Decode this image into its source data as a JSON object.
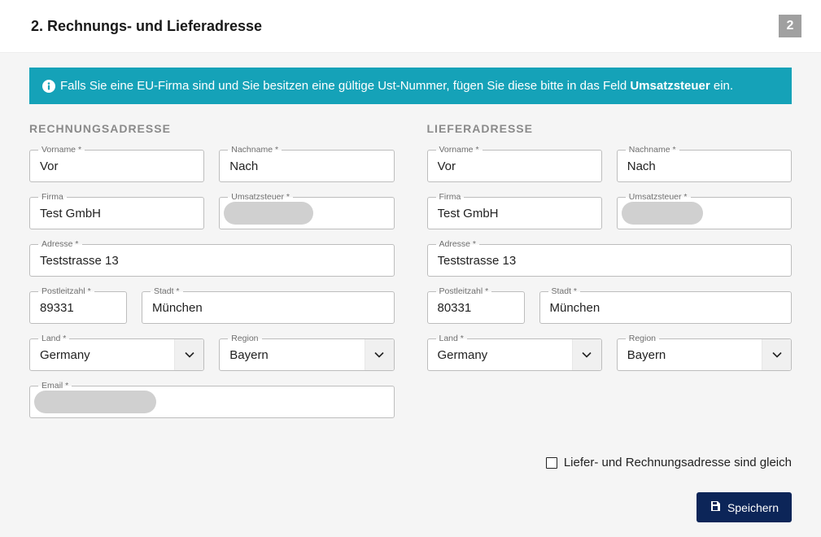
{
  "header": {
    "title": "2. Rechnungs- und Lieferadresse",
    "step": "2"
  },
  "banner": {
    "text_before": "Falls Sie eine EU-Firma sind und Sie besitzen eine gültige Ust-Nummer, fügen Sie diese bitte in das Feld ",
    "bold": "Umsatzsteuer",
    "text_after": " ein."
  },
  "billing": {
    "heading": "RECHNUNGSADRESSE",
    "firstname": {
      "label": "Vorname *",
      "value": "Vor"
    },
    "lastname": {
      "label": "Nachname *",
      "value": "Nach"
    },
    "company": {
      "label": "Firma",
      "value": "Test GmbH"
    },
    "vat": {
      "label": "Umsatzsteuer *",
      "value": ""
    },
    "address": {
      "label": "Adresse *",
      "value": "Teststrasse 13"
    },
    "postcode": {
      "label": "Postleitzahl *",
      "value": "89331"
    },
    "city": {
      "label": "Stadt *",
      "value": "München"
    },
    "country": {
      "label": "Land *",
      "value": "Germany"
    },
    "region": {
      "label": "Region",
      "value": "Bayern"
    },
    "email": {
      "label": "Email *",
      "value": ""
    }
  },
  "shipping": {
    "heading": "LIEFERADRESSE",
    "firstname": {
      "label": "Vorname *",
      "value": "Vor"
    },
    "lastname": {
      "label": "Nachname *",
      "value": "Nach"
    },
    "company": {
      "label": "Firma",
      "value": "Test GmbH"
    },
    "vat": {
      "label": "Umsatzsteuer *",
      "value": ""
    },
    "address": {
      "label": "Adresse *",
      "value": "Teststrasse 13"
    },
    "postcode": {
      "label": "Postleitzahl *",
      "value": "80331"
    },
    "city": {
      "label": "Stadt *",
      "value": "München"
    },
    "country": {
      "label": "Land *",
      "value": "Germany"
    },
    "region": {
      "label": "Region",
      "value": "Bayern"
    }
  },
  "same_address_label": "Liefer- und Rechnungsadresse sind gleich",
  "save_label": "Speichern"
}
